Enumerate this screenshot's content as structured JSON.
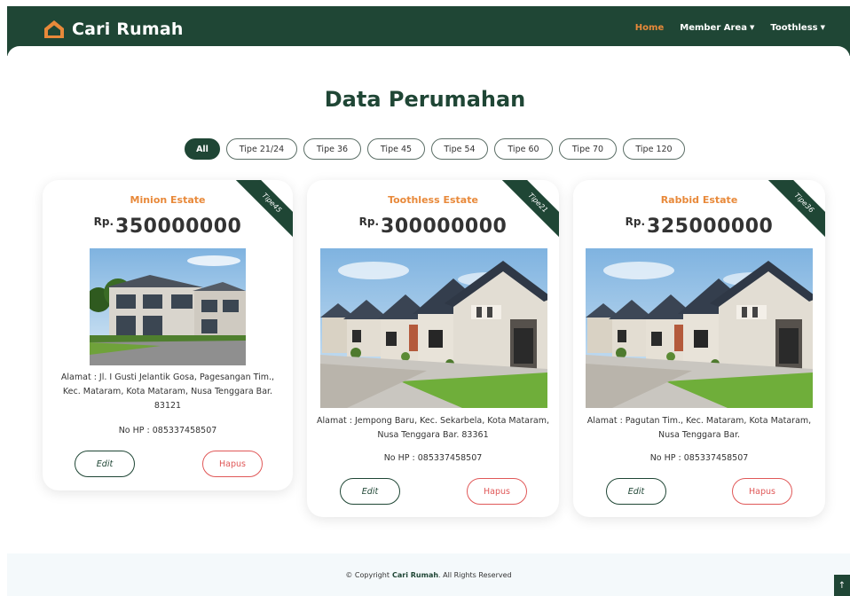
{
  "brand": {
    "name": "Cari Rumah",
    "icon": "house-icon"
  },
  "nav": {
    "items": [
      {
        "label": "Home",
        "active": true
      },
      {
        "label": "Member Area",
        "dropdown": true
      },
      {
        "label": "Toothless",
        "dropdown": true
      }
    ]
  },
  "page": {
    "title": "Data Perumahan"
  },
  "filters": [
    "All",
    "Tipe 21/24",
    "Tipe 36",
    "Tipe 45",
    "Tipe 54",
    "Tipe 60",
    "Tipe 70",
    "Tipe 120"
  ],
  "listings": [
    {
      "name": "Minion Estate",
      "type": "Tipe45",
      "price_prefix": "Rp.",
      "price": "350000000",
      "address": "Alamat : Jl. I Gusti Jelantik Gosa, Pagesangan Tim., Kec. Mataram, Kota Mataram, Nusa Tenggara Bar. 83121",
      "phone": "No HP : 085337458507",
      "edit_label": "Edit",
      "delete_label": "Hapus"
    },
    {
      "name": "Toothless Estate",
      "type": "Tipe21",
      "price_prefix": "Rp.",
      "price": "300000000",
      "address": "Alamat : Jempong Baru, Kec. Sekarbela, Kota Mataram, Nusa Tenggara Bar. 83361",
      "phone": "No HP : 085337458507",
      "edit_label": "Edit",
      "delete_label": "Hapus"
    },
    {
      "name": "Rabbid Estate",
      "type": "Tipe36",
      "price_prefix": "Rp.",
      "price": "325000000",
      "address": "Alamat : Pagutan Tim., Kec. Mataram, Kota Mataram, Nusa Tenggara Bar.",
      "phone": "No HP : 085337458507",
      "edit_label": "Edit",
      "delete_label": "Hapus"
    }
  ],
  "footer": {
    "prefix": "© Copyright",
    "brand": "Cari Rumah",
    "suffix": ". All Rights Reserved"
  },
  "colors": {
    "primary": "#1f4635",
    "accent": "#e8893a",
    "danger": "#e05858"
  }
}
